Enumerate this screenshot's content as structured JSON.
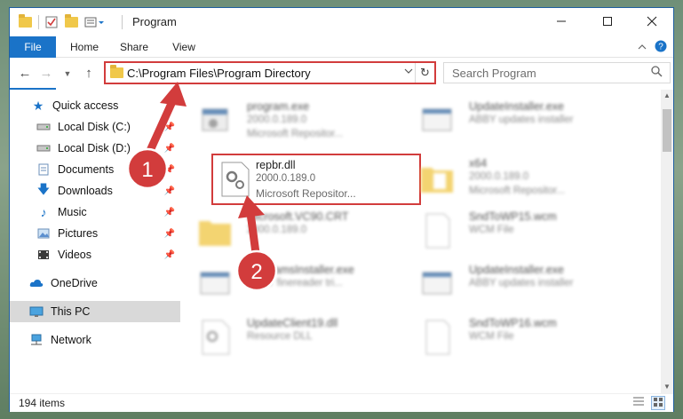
{
  "window": {
    "title": "Program"
  },
  "ribbon": {
    "tabs": [
      "File",
      "Home",
      "Share",
      "View"
    ]
  },
  "address": {
    "path": "C:\\Program Files\\Program Directory"
  },
  "search": {
    "placeholder": "Search Program"
  },
  "sidebar": {
    "items": [
      {
        "label": "Quick access",
        "icon": "star-icon",
        "pinned": false
      },
      {
        "label": "Local Disk (C:)",
        "icon": "drive-icon",
        "pinned": true
      },
      {
        "label": "Local Disk (D:)",
        "icon": "drive-icon",
        "pinned": true
      },
      {
        "label": "Documents",
        "icon": "documents-icon",
        "pinned": true
      },
      {
        "label": "Downloads",
        "icon": "download-icon",
        "pinned": true
      },
      {
        "label": "Music",
        "icon": "music-icon",
        "pinned": true
      },
      {
        "label": "Pictures",
        "icon": "pictures-icon",
        "pinned": true
      },
      {
        "label": "Videos",
        "icon": "videos-icon",
        "pinned": true
      },
      {
        "label": "OneDrive",
        "icon": "cloud-icon",
        "pinned": false
      },
      {
        "label": "This PC",
        "icon": "computer-icon",
        "pinned": false,
        "selected": true
      },
      {
        "label": "Network",
        "icon": "network-icon",
        "pinned": false
      }
    ]
  },
  "files": [
    {
      "name": "program.exe",
      "line2": "2000.0.189.0",
      "line3": "Microsoft Repositor...",
      "kind": "exe"
    },
    {
      "name": "UpdateInstaller.exe",
      "line2": "ABBY updates installer",
      "line3": "",
      "kind": "exe"
    },
    {
      "name": "repbr.dll",
      "line2": "2000.0.189.0",
      "line3": "Microsoft Repositor...",
      "kind": "dll",
      "highlighted": true
    },
    {
      "name": "x64",
      "line2": "2000.0.189.0",
      "line3": "Microsoft Repositor...",
      "kind": "folder"
    },
    {
      "name": "Microsoft.VC90.CRT",
      "line2": "2000.0.189.0",
      "line3": "",
      "kind": "folder"
    },
    {
      "name": "SndToWP15.wcm",
      "line2": "WCM File",
      "line3": "",
      "kind": "doc"
    },
    {
      "name": "ProgramsInstaller.exe",
      "line2": "ABBY finereader tri...",
      "line3": "",
      "kind": "exe"
    },
    {
      "name": "UpdateInstaller.exe",
      "line2": "ABBY updates installer",
      "line3": "",
      "kind": "exe"
    },
    {
      "name": "UpdateClient19.dll",
      "line2": "Resource DLL",
      "line3": "",
      "kind": "dll"
    },
    {
      "name": "SndToWP16.wcm",
      "line2": "WCM File",
      "line3": "",
      "kind": "doc"
    }
  ],
  "status": {
    "items_count": "194 items"
  },
  "annotations": {
    "step1": "1",
    "step2": "2"
  },
  "colors": {
    "accent": "#1a73c8",
    "highlight": "#d23c3c"
  }
}
